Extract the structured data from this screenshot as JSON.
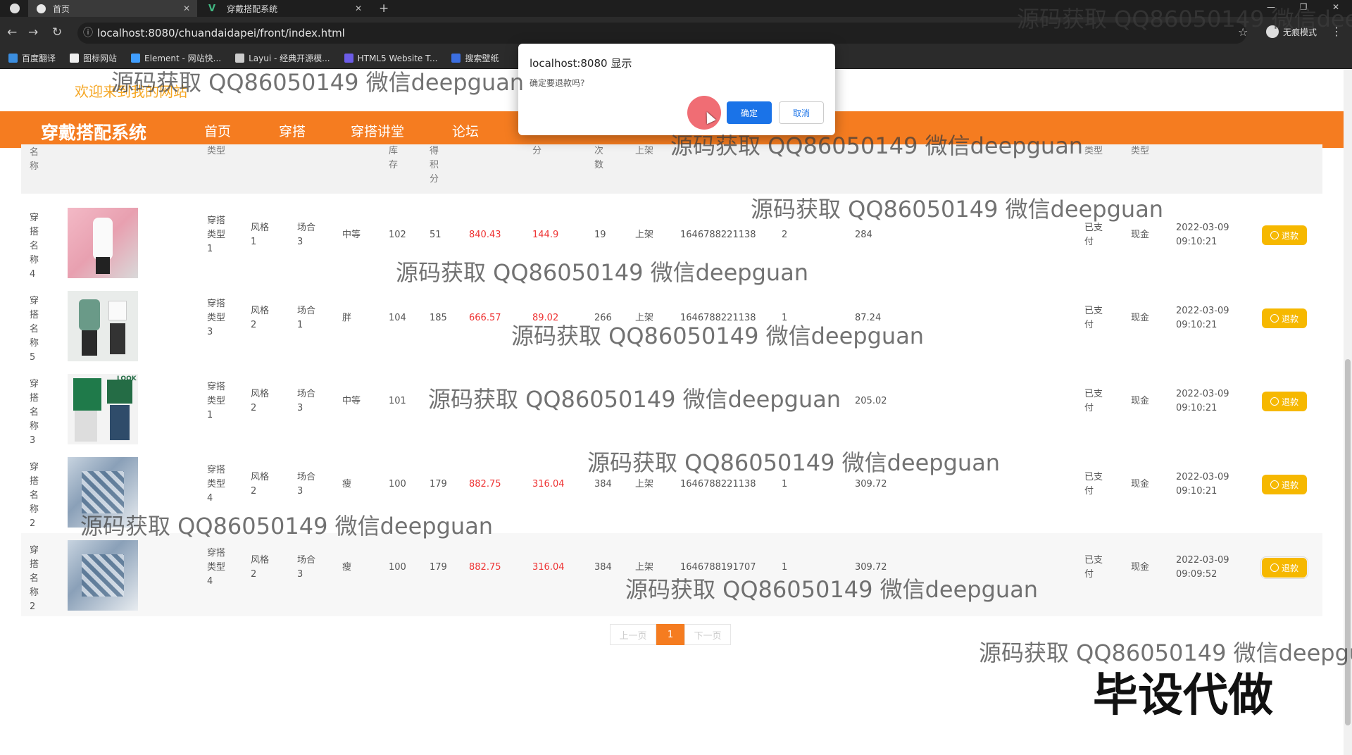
{
  "browser": {
    "tabs": [
      {
        "title": "首页",
        "active": true
      },
      {
        "title": "穿戴搭配系统",
        "active": false
      }
    ],
    "url": "localhost:8080/chuandaidapei/front/index.html",
    "incognito_label": "无痕模式",
    "bookmarks": [
      "百度翻译",
      "图标网站",
      "Element - 网站快...",
      "Layui - 经典开源模...",
      "HTML5 Website T...",
      "搜索壁纸"
    ]
  },
  "site": {
    "welcome": "欢迎来到我的网站",
    "brand": "穿戴搭配系统",
    "nav": [
      "首页",
      "穿搭",
      "穿搭讲堂",
      "论坛"
    ]
  },
  "table": {
    "headers": {
      "name": "名称",
      "type": "类型",
      "stock": "库存",
      "points": "得积分",
      "fen": "分",
      "times": "次数",
      "onshelf": "上架",
      "paytype": "类型",
      "paytype2": "类型"
    },
    "rows": [
      {
        "name": "穿搭名称4",
        "type": "穿搭类型1",
        "style": "风格1",
        "occasion": "场合3",
        "body": "中等",
        "stock": "102",
        "points": "51",
        "price": "840.43",
        "score": "144.9",
        "count": "19",
        "status": "上架",
        "code": "1646788221138",
        "qty": "2",
        "total": "284",
        "paid": "已支付",
        "method": "现金",
        "date": "2022-03-09",
        "time": "09:10:21"
      },
      {
        "name": "穿搭名称5",
        "type": "穿搭类型3",
        "style": "风格2",
        "occasion": "场合1",
        "body": "胖",
        "stock": "104",
        "points": "185",
        "price": "666.57",
        "score": "89.02",
        "count": "266",
        "status": "上架",
        "code": "1646788221138",
        "qty": "1",
        "total": "87.24",
        "paid": "已支付",
        "method": "现金",
        "date": "2022-03-09",
        "time": "09:10:21"
      },
      {
        "name": "穿搭名称3",
        "type": "穿搭类型1",
        "style": "风格2",
        "occasion": "场合3",
        "body": "中等",
        "stock": "101",
        "points": "",
        "price": "",
        "score": "",
        "count": "",
        "status": "",
        "code": "",
        "qty": "",
        "total": "205.02",
        "paid": "已支付",
        "method": "现金",
        "date": "2022-03-09",
        "time": "09:10:21"
      },
      {
        "name": "穿搭名称2",
        "type": "穿搭类型4",
        "style": "风格2",
        "occasion": "场合3",
        "body": "瘦",
        "stock": "100",
        "points": "179",
        "price": "882.75",
        "score": "316.04",
        "count": "384",
        "status": "上架",
        "code": "1646788221138",
        "qty": "1",
        "total": "309.72",
        "paid": "已支付",
        "method": "现金",
        "date": "2022-03-09",
        "time": "09:10:21"
      },
      {
        "name": "穿搭名称2",
        "type": "穿搭类型4",
        "style": "风格2",
        "occasion": "场合3",
        "body": "瘦",
        "stock": "100",
        "points": "179",
        "price": "882.75",
        "score": "316.04",
        "count": "384",
        "status": "上架",
        "code": "1646788191707",
        "qty": "1",
        "total": "309.72",
        "paid": "已支付",
        "method": "现金",
        "date": "2022-03-09",
        "time": "09:09:52"
      }
    ],
    "refund_label": "退款"
  },
  "pagination": {
    "prev": "上一页",
    "current": "1",
    "next": "下一页"
  },
  "dialog": {
    "title": "localhost:8080 显示",
    "message": "确定要退款吗?",
    "ok": "确定",
    "cancel": "取消"
  },
  "watermark": {
    "text": "源码获取 QQ86050149 微信deepguan",
    "big": "毕设代做"
  },
  "colors": {
    "accent": "#f57c20",
    "refund": "#f6b800",
    "price_red": "#e33",
    "dialog_blue": "#1a73e8"
  }
}
